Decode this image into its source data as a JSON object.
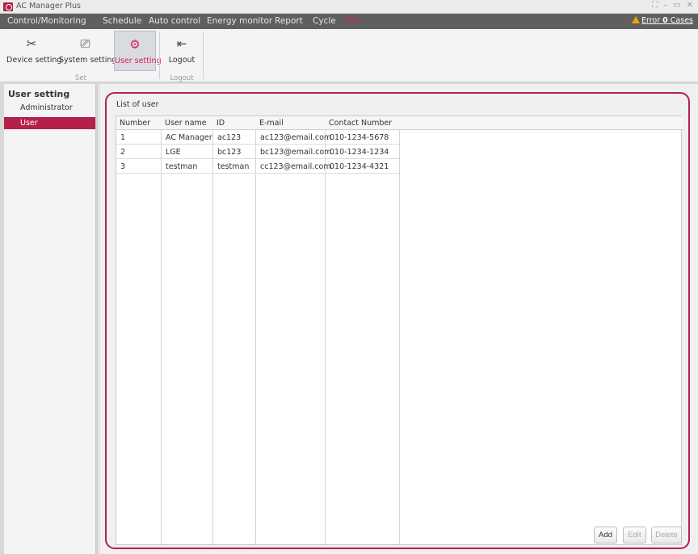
{
  "app": {
    "title": "AC Manager Plus",
    "window_controls": [
      "⛶",
      "–",
      "▭",
      "✕"
    ]
  },
  "menu": {
    "items": [
      "Control/Monitoring",
      "Schedule",
      "Auto control",
      "Energy monitor",
      "Report",
      "Cycle",
      "Set"
    ],
    "active": "Set",
    "error": {
      "label": "Error",
      "count": "0",
      "unit": "Cases"
    }
  },
  "ribbon": {
    "buttons": [
      {
        "label": "Device setting",
        "icon": "tools-icon",
        "glyph": "✂"
      },
      {
        "label": "System setting",
        "icon": "monitor-settings-icon",
        "glyph": "⎚"
      },
      {
        "label": "User setting",
        "icon": "user-settings-icon",
        "glyph": "⚙"
      },
      {
        "label": "Logout",
        "icon": "logout-icon",
        "glyph": "⇤"
      }
    ],
    "groups": [
      "Set",
      "Logout"
    ],
    "selected": "User setting"
  },
  "sidebar": {
    "title": "User setting",
    "items": [
      {
        "label": "Administrator"
      },
      {
        "label": "User"
      }
    ],
    "active": "User"
  },
  "main": {
    "list_title": "List of user",
    "columns": [
      "Number",
      "User name",
      "ID",
      "E-mail",
      "Contact Number"
    ],
    "rows": [
      [
        "1",
        "AC Manager",
        "ac123",
        "ac123@email.com",
        "010-1234-5678"
      ],
      [
        "2",
        "LGE",
        "bc123",
        "bc123@email.com",
        "010-1234-1234"
      ],
      [
        "3",
        "testman",
        "testman",
        "cc123@email.com",
        "010-1234-4321"
      ]
    ],
    "buttons": {
      "add": "Add",
      "edit": "Edit",
      "delete": "Delete"
    }
  },
  "colors": {
    "accent": "#b4204a",
    "menu_bg": "#5f5f5f",
    "warning": "#f0a500"
  }
}
